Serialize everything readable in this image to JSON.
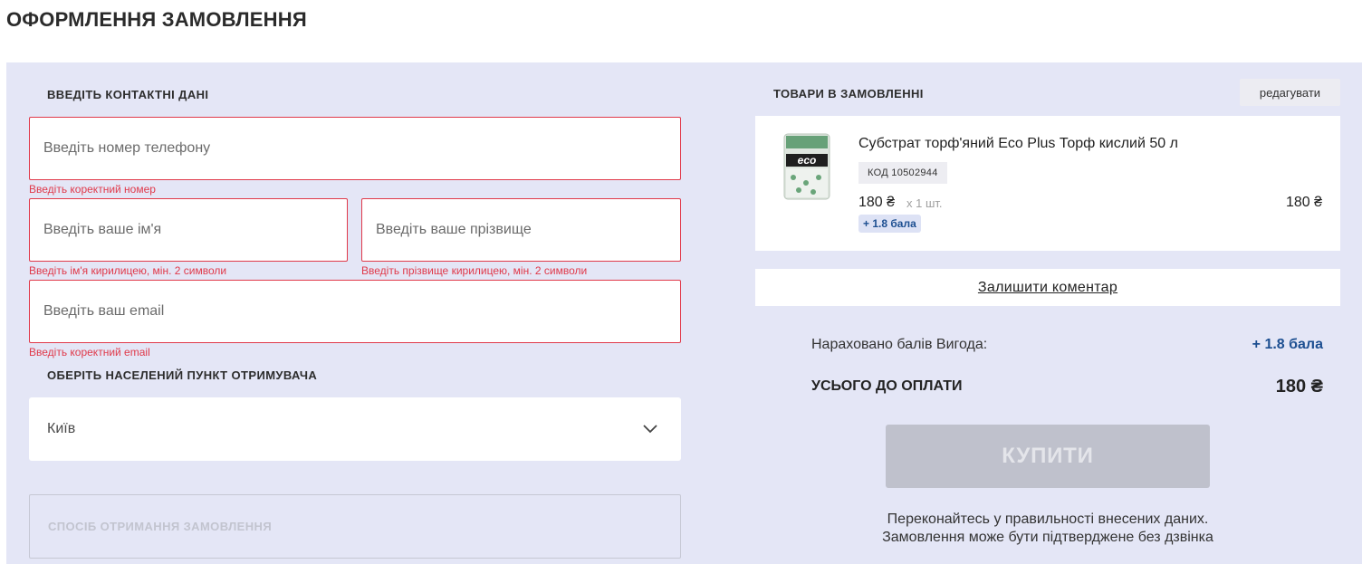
{
  "page": {
    "title": "ОФОРМЛЕННЯ ЗАМОВЛЕННЯ"
  },
  "contacts": {
    "section_label": "ВВЕДІТЬ КОНТАКТНІ ДАНІ",
    "phone": {
      "value": "",
      "placeholder": "Введіть номер телефону",
      "error": "Введіть коректний номер"
    },
    "first_name": {
      "value": "",
      "placeholder": "Введіть ваше ім'я",
      "error": "Введіть ім'я кирилицею, мін. 2 символи"
    },
    "last_name": {
      "value": "",
      "placeholder": "Введіть ваше прізвище",
      "error": "Введіть прізвище кирилицею, мін. 2 символи"
    },
    "email": {
      "value": "",
      "placeholder": "Введіть ваш email",
      "error": "Введіть коректний email"
    }
  },
  "city": {
    "section_label": "ОБЕРІТЬ НАСЕЛЕНИЙ ПУНКТ ОТРИМУВАЧА",
    "selected": "Київ",
    "icon": "chevron-down-icon"
  },
  "delivery": {
    "label": "СПОСІБ ОТРИМАННЯ ЗАМОВЛЕННЯ"
  },
  "order": {
    "section_label": "ТОВАРИ В ЗАМОВЛЕННІ",
    "edit_label": "редагувати",
    "items": [
      {
        "name": "Субстрат торф'яний Eco Plus Торф кислий 50 л",
        "code": "КОД 10502944",
        "price": "180 ₴",
        "qty": "x 1 шт.",
        "bonus": "+ 1.8 бала",
        "total": "180 ₴",
        "image_logo": "eco"
      }
    ],
    "comment_label": "Залишити коментар"
  },
  "summary": {
    "points_label": "Нараховано балів Вигода:",
    "points_value": "+ 1.8 бала",
    "total_label": "УСЬОГО ДО ОПЛАТИ",
    "total_value": "180 ₴",
    "buy_label": "КУПИТИ",
    "note_line1": "Переконайтесь у правильності внесених даних.",
    "note_line2": "Замовлення може бути підтверджене без дзвінка"
  },
  "colors": {
    "panel_bg": "#e4e6f6",
    "error": "#e0394a",
    "accent_blue": "#1d4f91",
    "disabled_button": "#bfc1cc"
  }
}
